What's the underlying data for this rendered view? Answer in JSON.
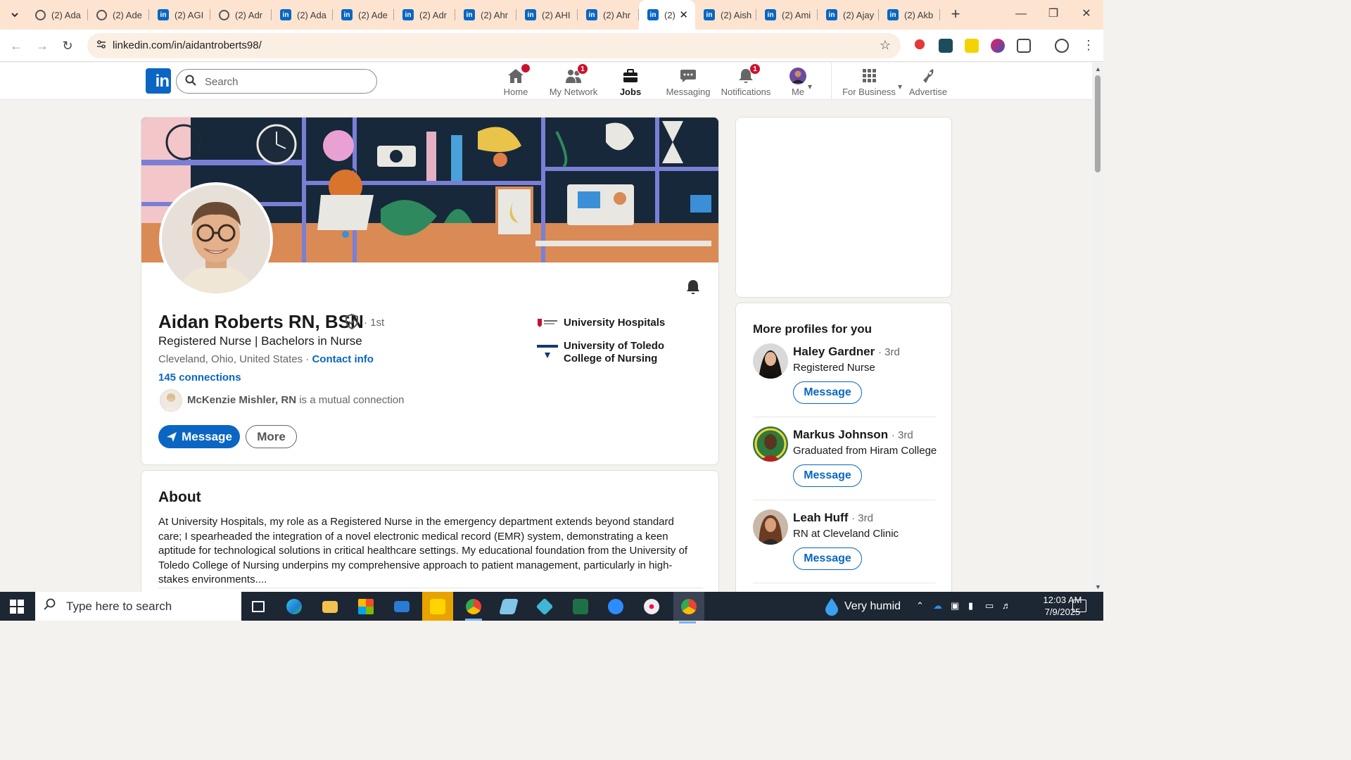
{
  "browser": {
    "tabs": [
      {
        "title": "(2) Ada",
        "icon": "spiral-icon",
        "active": false
      },
      {
        "title": "(2) Ade",
        "icon": "quill-icon",
        "active": false
      },
      {
        "title": "(2) AGI",
        "icon": "linkedin-icon",
        "active": false
      },
      {
        "title": "(2) Adr",
        "icon": "spiral-icon",
        "active": false
      },
      {
        "title": "(2) Ada",
        "icon": "linkedin-icon",
        "active": false
      },
      {
        "title": "(2) Ade",
        "icon": "linkedin-icon",
        "active": false
      },
      {
        "title": "(2) Adr",
        "icon": "linkedin-icon",
        "active": false
      },
      {
        "title": "(2) Ahr",
        "icon": "linkedin-icon",
        "active": false
      },
      {
        "title": "(2) AHI",
        "icon": "linkedin-icon",
        "active": false
      },
      {
        "title": "(2) Ahr",
        "icon": "linkedin-icon",
        "active": false
      },
      {
        "title": "(2)",
        "icon": "linkedin-icon",
        "active": true
      },
      {
        "title": "(2) Aish",
        "icon": "linkedin-icon",
        "active": false
      },
      {
        "title": "(2) Ami",
        "icon": "linkedin-icon",
        "active": false
      },
      {
        "title": "(2) Ajay",
        "icon": "linkedin-icon",
        "active": false
      },
      {
        "title": "(2) Akb",
        "icon": "linkedin-icon",
        "active": false
      }
    ],
    "url": "linkedin.com/in/aidantroberts98/"
  },
  "header": {
    "logo": "in",
    "search_placeholder": "Search",
    "nav": [
      {
        "label": "Home",
        "icon": "home-icon",
        "badge": "",
        "active": false
      },
      {
        "label": "My Network",
        "icon": "network-icon",
        "badge": "1",
        "active": false
      },
      {
        "label": "Jobs",
        "icon": "briefcase-icon",
        "badge": "",
        "active": true
      },
      {
        "label": "Messaging",
        "icon": "chat-icon",
        "badge": "",
        "active": false
      },
      {
        "label": "Notifications",
        "icon": "bell-icon",
        "badge": "1",
        "active": false
      },
      {
        "label": "Me",
        "icon": "avatar-icon",
        "badge": "",
        "active": false
      },
      {
        "label": "For Business",
        "icon": "grid-icon",
        "badge": "",
        "active": false
      },
      {
        "label": "Advertise",
        "icon": "advertise-icon",
        "badge": "",
        "active": false
      }
    ]
  },
  "profile": {
    "name": "Aidan Roberts RN, BSN",
    "degree": "· 1st",
    "headline": "Registered Nurse | Bachelors in Nurse",
    "location": "Cleveland, Ohio, United States",
    "location_sep": "·",
    "contact_info": "Contact info",
    "connections": "145 connections",
    "mutual_name": "McKenzie Mishler, RN",
    "mutual_suffix": "is a mutual connection",
    "message_button": "Message",
    "more_button": "More",
    "orgs": [
      {
        "name": "University Hospitals",
        "logo": "university-hospitals-logo"
      },
      {
        "name": "University of Toledo College of Nursing",
        "logo": "nursing-logo"
      }
    ]
  },
  "about": {
    "title": "About",
    "text": "At University Hospitals, my role as a Registered Nurse in the emergency department extends beyond standard care; I spearheaded the integration of a novel electronic medical record (EMR) system, demonstrating a keen aptitude for technological solutions in critical healthcare settings. My educational foundation from the University of Toledo College of Nursing underpins my comprehensive approach to patient management, particularly in high-stakes environments...."
  },
  "more_profiles": {
    "title": "More profiles for you",
    "people": [
      {
        "name": "Haley Gardner",
        "degree": "· 3rd",
        "headline": "Registered Nurse",
        "button": "Message"
      },
      {
        "name": "Markus Johnson",
        "degree": "· 3rd",
        "headline": "Graduated from Hiram College",
        "button": "Message"
      },
      {
        "name": "Leah Huff",
        "degree": "· 3rd",
        "headline": "RN at Cleveland Clinic",
        "button": "Message"
      }
    ]
  },
  "taskbar": {
    "search_placeholder": "Type here to search",
    "weather": "Very humid",
    "time": "12:03 AM",
    "date": "7/9/2025"
  },
  "colors": {
    "linkedin_blue": "#0a66c2",
    "badge_red": "#cb112d",
    "tabstrip": "#fde4d1"
  }
}
